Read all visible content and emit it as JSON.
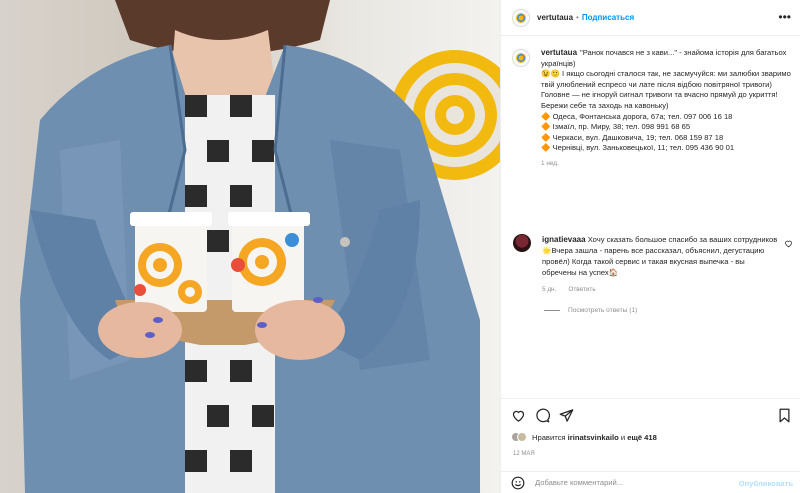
{
  "post": {
    "username": "vertutaua",
    "follow_label": "Подписаться",
    "dot": "•",
    "more": "•••",
    "caption_lines": [
      "\"Ранок почався не з кави...\" - знайома історія для багатьох українців)",
      "😉🙂 І якщо сьогодні сталося так, не засмучуйся: ми залюбки зваримо твій улюблений еспресо чи лате після відбою повітряної тривоги)",
      "Головне — не ігноруй сигнал тривоги та вчасно прямуй до укриття!",
      "",
      "Бережи себе та заходь на кавоньку)",
      "",
      "🔶 Одеса, Фонтанська дорога, 67а; тел. 097 006 16 18",
      "🔶 Ізмаїл, пр. Миру, 38; тел. 098 991 68 65",
      "🔶 Черкаси, вул. Дашковича, 19; тел. 068 159 87 18",
      "🔶 Чернівці, вул. Заньковецької, 11; тел. 095 436 90 01"
    ],
    "caption_age": "1 нед."
  },
  "comment": {
    "username": "ignatievaaa",
    "text": "Хочу сказать большое спасибо за ваших сотрудников🌟Вчера зашла - парень все рассказал, объяснил, дегустацию провёл) Когда такой сервис и такая вкусная выпечка - вы обречены на успех🏠",
    "age": "5 дн.",
    "reply_label": "Ответить",
    "view_replies": "Посмотреть ответы (1)"
  },
  "likes": {
    "prefix": "Нравится",
    "user": "irinatsvinkailo",
    "middle": "и",
    "others": "ещё 418"
  },
  "date": "12 мая",
  "add_comment_placeholder": "Добавьте комментарий...",
  "publish_label": "Опубликовать",
  "icons": [
    "heart-icon",
    "comment-icon",
    "share-icon",
    "bookmark-icon",
    "emoji-icon",
    "more-icon"
  ]
}
